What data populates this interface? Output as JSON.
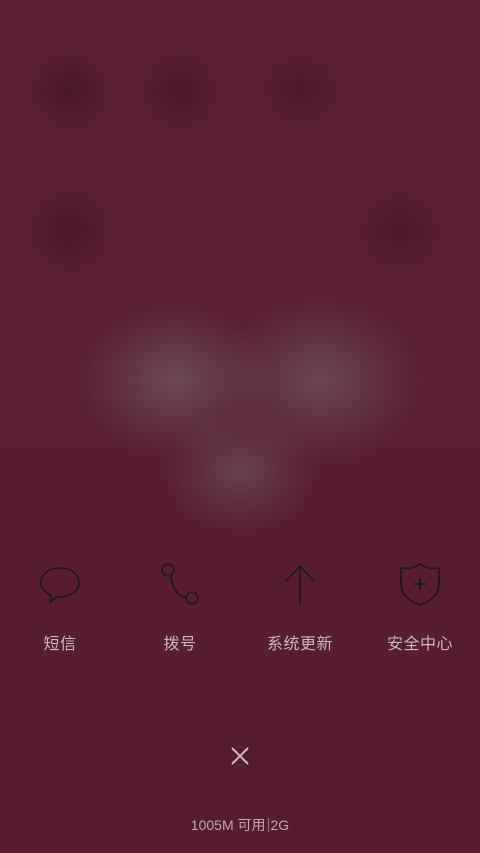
{
  "actions": [
    {
      "label": "短信",
      "icon": "message-bubble-icon"
    },
    {
      "label": "拨号",
      "icon": "dial-icon"
    },
    {
      "label": "系统更新",
      "icon": "arrow-up-icon"
    },
    {
      "label": "安全中心",
      "icon": "shield-plus-icon"
    }
  ],
  "close": {
    "icon": "close-icon"
  },
  "status": {
    "memory": "1005M 可用",
    "network": "2G"
  },
  "colors": {
    "background": "#5a1f33",
    "icon_stroke": "#1a1a1a",
    "label_text": "#c9b8bf"
  }
}
